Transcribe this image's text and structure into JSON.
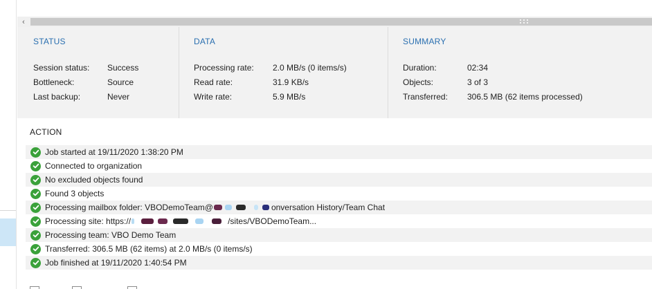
{
  "scrollbar": {
    "left_arrow_glyph": "‹"
  },
  "status": {
    "title": "STATUS",
    "rows": [
      {
        "label": "Session status:",
        "value": "Success"
      },
      {
        "label": "Bottleneck:",
        "value": "Source"
      },
      {
        "label": "Last backup:",
        "value": "Never"
      }
    ]
  },
  "data": {
    "title": "DATA",
    "rows": [
      {
        "label": "Processing rate:",
        "value": "2.0 MB/s (0 items/s)"
      },
      {
        "label": "Read rate:",
        "value": "31.9 KB/s"
      },
      {
        "label": "Write rate:",
        "value": "5.9 MB/s"
      }
    ]
  },
  "summary": {
    "title": "SUMMARY",
    "rows": [
      {
        "label": "Duration:",
        "value": "02:34"
      },
      {
        "label": "Objects:",
        "value": "3 of 3"
      },
      {
        "label": "Transferred:",
        "value": "306.5 MB (62 items processed)"
      }
    ]
  },
  "action": {
    "title": "ACTION",
    "items": [
      {
        "icon": "success-check-icon",
        "text": "Job started at 19/11/2020 1:38:20 PM"
      },
      {
        "icon": "success-check-icon",
        "text": "Connected to organization"
      },
      {
        "icon": "success-check-icon",
        "text": "No excluded objects found"
      },
      {
        "icon": "success-check-icon",
        "text": "Found 3 objects"
      },
      {
        "icon": "success-check-icon",
        "text_before": "Processing mailbox folder: VBODemoTeam@",
        "text_after": "onversation History/Team Chat"
      },
      {
        "icon": "success-check-icon",
        "text_before": "Processing site: https://",
        "text_after": "/sites/VBODemoTeam..."
      },
      {
        "icon": "success-check-icon",
        "text": "Processing team: VBO Demo Team"
      },
      {
        "icon": "success-check-icon",
        "text": "Transferred: 306.5 MB (62 items) at 2.0 MB/s (0 items/s)"
      },
      {
        "icon": "success-check-icon",
        "text": "Job finished at 19/11/2020 1:40:54 PM"
      }
    ]
  },
  "colors": {
    "section_title": "#2a6fb0",
    "success": "#3aa13a",
    "panel_bg": "#f2f2f2",
    "scrollbar_thumb": "#c9c9c9"
  }
}
